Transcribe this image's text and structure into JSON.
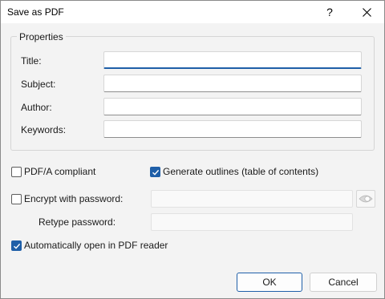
{
  "window": {
    "title": "Save as PDF",
    "help_glyph": "?",
    "icons": {
      "help": "question-mark-icon",
      "close": "close-icon"
    }
  },
  "properties": {
    "legend": "Properties",
    "title_label": "Title:",
    "title_value": "",
    "subject_label": "Subject:",
    "subject_value": "",
    "author_label": "Author:",
    "author_value": "",
    "keywords_label": "Keywords:",
    "keywords_value": ""
  },
  "options": {
    "pdfa_label": "PDF/A compliant",
    "pdfa_checked": false,
    "outlines_label": "Generate outlines (table of contents)",
    "outlines_checked": true,
    "encrypt_label": "Encrypt with password:",
    "encrypt_checked": false,
    "password_value": "",
    "retype_label": "Retype password:",
    "retype_value": "",
    "show_password_icon": "eye-icon",
    "autoopen_label": "Automatically open in PDF reader",
    "autoopen_checked": true
  },
  "buttons": {
    "ok_label": "OK",
    "cancel_label": "Cancel"
  },
  "colors": {
    "accent": "#1f5fa8",
    "dialog_bg": "#f3f3f3"
  }
}
